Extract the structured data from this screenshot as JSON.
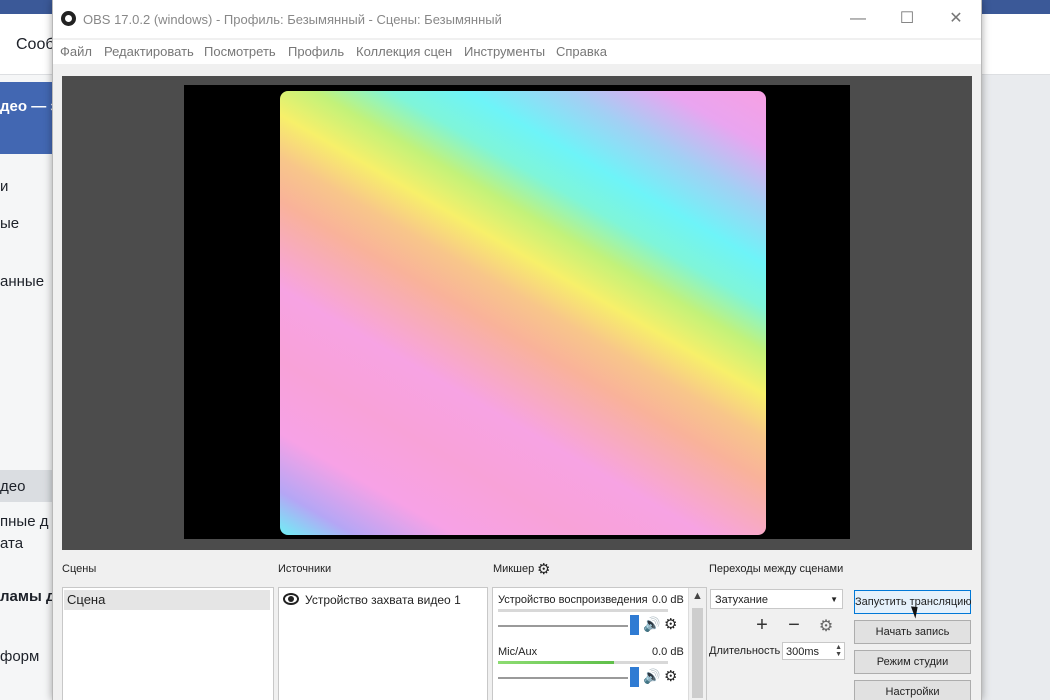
{
  "background_page": {
    "header_text": "Сооб",
    "side_active": "део — з",
    "side_items": [
      "и",
      "ые",
      "анные",
      "део",
      "пные д",
      "ата",
      "ламы д",
      "форм"
    ]
  },
  "window": {
    "title": "OBS 17.0.2 (windows) - Профиль: Безымянный - Сцены: Безымянный",
    "controls": {
      "minimize": "—",
      "maximize": "☐",
      "close": "✕"
    }
  },
  "menu": [
    "Файл",
    "Редактировать",
    "Посмотреть",
    "Профиль",
    "Коллекция сцен",
    "Инструменты",
    "Справка"
  ],
  "scenes": {
    "title": "Сцены",
    "items": [
      "Сцена"
    ]
  },
  "sources": {
    "title": "Источники",
    "items": [
      "Устройство захвата видео 1"
    ]
  },
  "mixer": {
    "title": "Микшер",
    "channels": [
      {
        "name": "Устройство воспроизведения",
        "db": "0.0 dB",
        "level": 0.0
      },
      {
        "name": "Mic/Aux",
        "db": "0.0 dB",
        "level": 0.68
      }
    ]
  },
  "transitions": {
    "title": "Переходы между сценами",
    "selected": "Затухание",
    "duration_label": "Длительность",
    "duration_value": "300ms"
  },
  "controls": {
    "start_stream": "Запустить трансляцию",
    "start_record": "Начать запись",
    "studio_mode": "Режим студии",
    "settings": "Настройки"
  }
}
